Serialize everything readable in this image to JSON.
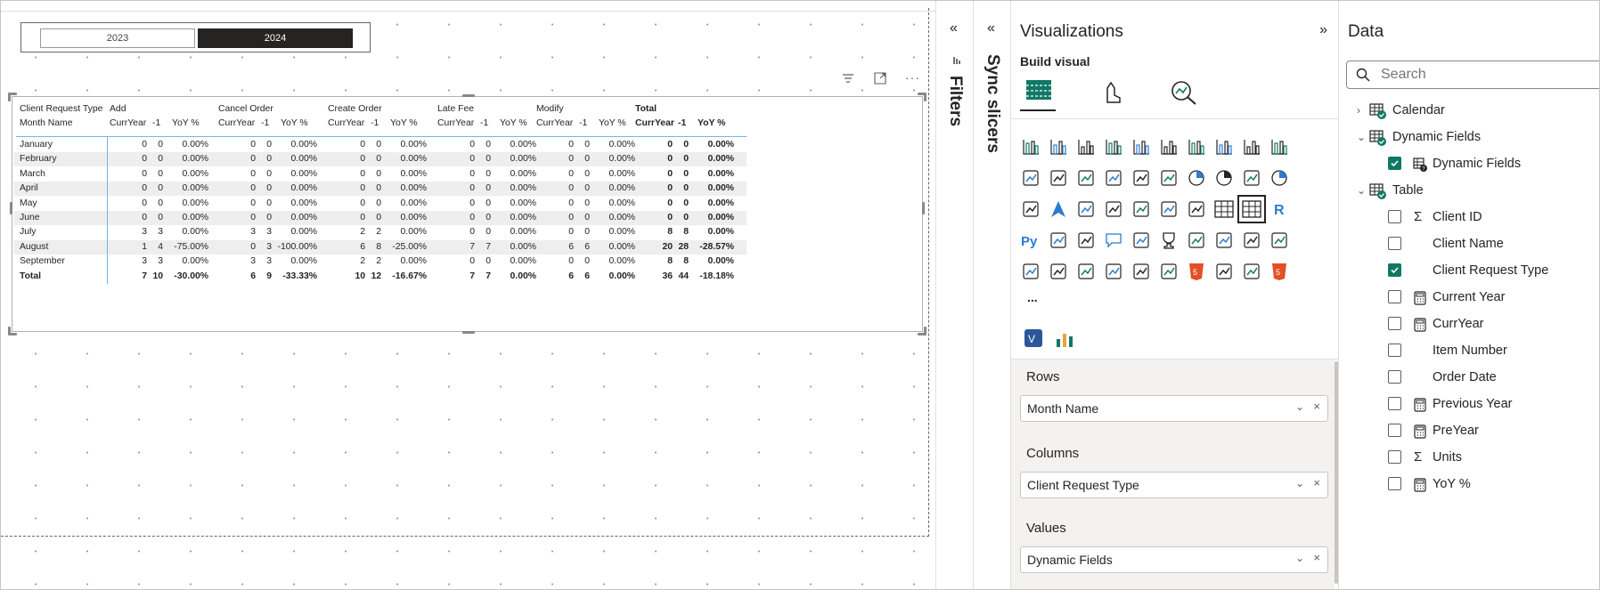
{
  "slicer": {
    "options": [
      "2023",
      "2024"
    ],
    "selected": "2024"
  },
  "matrix": {
    "row_header_1": "Client Request Type",
    "row_header_2": "Month Name",
    "groups": [
      "Add",
      "Cancel Order",
      "Create Order",
      "Late Fee",
      "Modify",
      "Total"
    ],
    "measure_headers": [
      "CurrYear",
      "-1",
      "YoY %"
    ],
    "rows": [
      {
        "month": "January",
        "vals": [
          "0",
          "0",
          "0.00%",
          "0",
          "0",
          "0.00%",
          "0",
          "0",
          "0.00%",
          "0",
          "0",
          "0.00%",
          "0",
          "0",
          "0.00%",
          "0",
          "0",
          "0.00%"
        ]
      },
      {
        "month": "February",
        "vals": [
          "0",
          "0",
          "0.00%",
          "0",
          "0",
          "0.00%",
          "0",
          "0",
          "0.00%",
          "0",
          "0",
          "0.00%",
          "0",
          "0",
          "0.00%",
          "0",
          "0",
          "0.00%"
        ]
      },
      {
        "month": "March",
        "vals": [
          "0",
          "0",
          "0.00%",
          "0",
          "0",
          "0.00%",
          "0",
          "0",
          "0.00%",
          "0",
          "0",
          "0.00%",
          "0",
          "0",
          "0.00%",
          "0",
          "0",
          "0.00%"
        ]
      },
      {
        "month": "April",
        "vals": [
          "0",
          "0",
          "0.00%",
          "0",
          "0",
          "0.00%",
          "0",
          "0",
          "0.00%",
          "0",
          "0",
          "0.00%",
          "0",
          "0",
          "0.00%",
          "0",
          "0",
          "0.00%"
        ]
      },
      {
        "month": "May",
        "vals": [
          "0",
          "0",
          "0.00%",
          "0",
          "0",
          "0.00%",
          "0",
          "0",
          "0.00%",
          "0",
          "0",
          "0.00%",
          "0",
          "0",
          "0.00%",
          "0",
          "0",
          "0.00%"
        ]
      },
      {
        "month": "June",
        "vals": [
          "0",
          "0",
          "0.00%",
          "0",
          "0",
          "0.00%",
          "0",
          "0",
          "0.00%",
          "0",
          "0",
          "0.00%",
          "0",
          "0",
          "0.00%",
          "0",
          "0",
          "0.00%"
        ]
      },
      {
        "month": "July",
        "vals": [
          "3",
          "3",
          "0.00%",
          "3",
          "3",
          "0.00%",
          "2",
          "2",
          "0.00%",
          "0",
          "0",
          "0.00%",
          "0",
          "0",
          "0.00%",
          "8",
          "8",
          "0.00%"
        ]
      },
      {
        "month": "August",
        "vals": [
          "1",
          "4",
          "-75.00%",
          "0",
          "3",
          "-100.00%",
          "6",
          "8",
          "-25.00%",
          "7",
          "7",
          "0.00%",
          "6",
          "6",
          "0.00%",
          "20",
          "28",
          "-28.57%"
        ]
      },
      {
        "month": "September",
        "vals": [
          "3",
          "3",
          "0.00%",
          "3",
          "3",
          "0.00%",
          "2",
          "2",
          "0.00%",
          "0",
          "0",
          "0.00%",
          "0",
          "0",
          "0.00%",
          "8",
          "8",
          "0.00%"
        ]
      }
    ],
    "total": {
      "label": "Total",
      "vals": [
        "7",
        "10",
        "-30.00%",
        "6",
        "9",
        "-33.33%",
        "10",
        "12",
        "-16.67%",
        "7",
        "7",
        "0.00%",
        "6",
        "6",
        "0.00%",
        "36",
        "44",
        "-18.18%"
      ]
    }
  },
  "filters_pane": {
    "label": "Filters",
    "collapse_glyph": "«"
  },
  "sync_pane": {
    "label": "Sync slicers",
    "collapse_glyph": "«"
  },
  "visualizations": {
    "title": "Visualizations",
    "expand_glyph": "»",
    "build_visual": "Build visual",
    "more": "...",
    "wells": [
      {
        "label": "Rows",
        "field": "Month Name"
      },
      {
        "label": "Columns",
        "field": "Client Request Type"
      },
      {
        "label": "Values",
        "field": "Dynamic Fields"
      }
    ]
  },
  "data_pane": {
    "title": "Data",
    "search_placeholder": "Search",
    "tables": [
      {
        "name": "Calendar",
        "expanded": false
      },
      {
        "name": "Dynamic Fields",
        "expanded": true
      },
      {
        "name": "Table",
        "expanded": true
      }
    ],
    "dynamic_fields_items": [
      {
        "name": "Dynamic Fields",
        "checked": true,
        "icon": "param-icon"
      }
    ],
    "table_fields": [
      {
        "name": "Client ID",
        "checked": false,
        "icon": "sigma-icon"
      },
      {
        "name": "Client Name",
        "checked": false,
        "icon": ""
      },
      {
        "name": "Client Request Type",
        "checked": true,
        "icon": ""
      },
      {
        "name": "Current Year",
        "checked": false,
        "icon": "calc-icon"
      },
      {
        "name": "CurrYear",
        "checked": false,
        "icon": "calc-icon"
      },
      {
        "name": "Item Number",
        "checked": false,
        "icon": ""
      },
      {
        "name": "Order Date",
        "checked": false,
        "icon": ""
      },
      {
        "name": "Previous Year",
        "checked": false,
        "icon": "calc-icon"
      },
      {
        "name": "PreYear",
        "checked": false,
        "icon": "calc-icon"
      },
      {
        "name": "Units",
        "checked": false,
        "icon": "sigma-icon"
      },
      {
        "name": "YoY %",
        "checked": false,
        "icon": "calc-icon"
      }
    ]
  },
  "colors": {
    "accent": "#117865",
    "matrix_line": "#6fb7e6",
    "slicer_selected": "#252423"
  }
}
